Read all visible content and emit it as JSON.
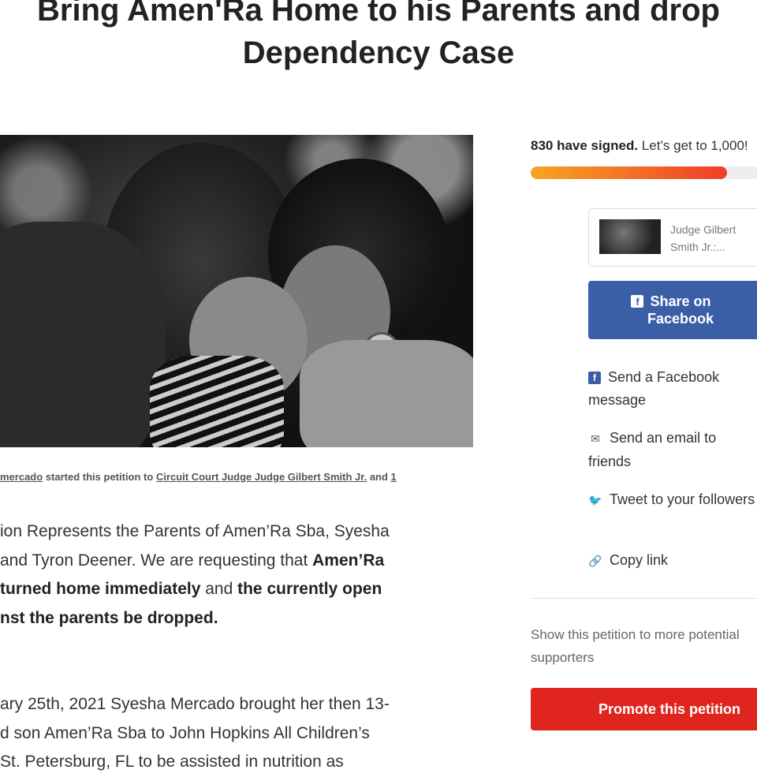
{
  "petition": {
    "title_line1": "Bring Amen'Ra Home to his Parents and drop",
    "title_line2": "Dependency Case"
  },
  "byline": {
    "author": "mercado",
    "text1": " started this petition to ",
    "target": "Circuit Court Judge Judge Gilbert Smith Jr.",
    "text2": " and ",
    "more": "1"
  },
  "body": {
    "p1_l1": "ion Represents the Parents of Amen’Ra Sba, Syesha",
    "p1_l2a": " and Tyron Deener. We are requesting that ",
    "p1_l2b": "Amen’Ra",
    "p1_l3a": "turned home immediately",
    "p1_l3b": " and ",
    "p1_l3c": "the currently open",
    "p1_l4": "nst the parents be dropped.",
    "p2_l1": "ary 25th, 2021 Syesha Mercado brought her then 13-",
    "p2_l2": "d son Amen’Ra Sba to John Hopkins All Children’s",
    "p2_l3": "St. Petersburg, FL to be assisted in nutrition as"
  },
  "sidebar": {
    "signed_count": "830 have signed.",
    "goal_text": " Let’s get to 1,000!",
    "progress": 0.83,
    "target_name": "Judge Gilbert Smith Jr.:...",
    "target_line1": "Judge Gilbert",
    "target_line2": "Smith Jr.:...",
    "fb_share_label": "Share on Facebook",
    "fb_share_line1": "Share on",
    "fb_share_line2": "Facebook",
    "share_fb_message": "Send a Facebook message",
    "share_email": "Send an email to friends",
    "share_tweet": "Tweet to your followers",
    "share_copy": "Copy link",
    "show_text_l1": "Show this petition to more potential",
    "show_text_l2": "supporters",
    "promote_label": "Promote this petition"
  },
  "icons": {
    "facebook": "facebook-icon",
    "email": "email-icon",
    "twitter": "twitter-icon",
    "link": "link-icon"
  },
  "colors": {
    "facebook_blue": "#3b5fa6",
    "promote_red": "#e0251f",
    "progress_start": "#f6a623",
    "progress_end": "#ef3d2a"
  }
}
